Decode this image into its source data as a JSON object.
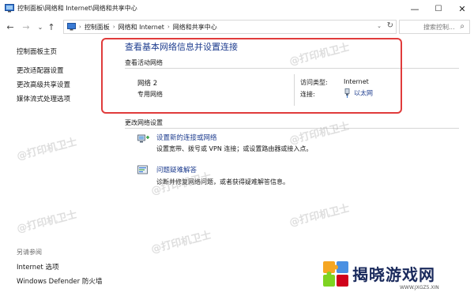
{
  "window": {
    "title": "控制面板\\网络和 Internet\\网络和共享中心",
    "minimize": "—",
    "maximize": "☐",
    "close": "✕"
  },
  "nav": {
    "back": "←",
    "forward": "→",
    "recent": "⌄",
    "up": "↑"
  },
  "address": {
    "crumbs": [
      "控制面板",
      "网络和 Internet",
      "网络和共享中心"
    ],
    "sep": "›",
    "dropdown": "⌄",
    "refresh": "↻"
  },
  "search": {
    "placeholder": "搜索控制...",
    "icon": "⌕"
  },
  "sidebar": {
    "items": [
      {
        "label": "控制面板主页"
      },
      {
        "label": "更改适配器设置"
      },
      {
        "label": "更改高级共享设置"
      },
      {
        "label": "媒体流式处理选项"
      }
    ],
    "see_also_title": "另请参阅",
    "see_also": [
      {
        "label": "Internet 选项"
      },
      {
        "label": "Windows Defender 防火墙"
      }
    ]
  },
  "main": {
    "heading": "查看基本网络信息并设置连接",
    "active_section": "查看活动网络",
    "network": {
      "name": "网络 2",
      "type": "专用网络",
      "access_label": "访问类型:",
      "access_value": "Internet",
      "conn_label": "连接:",
      "conn_value": "以太网"
    },
    "change_section": "更改网络设置",
    "tasks": [
      {
        "title": "设置新的连接或网络",
        "desc": "设置宽带、拨号或 VPN 连接；或设置路由器或接入点。"
      },
      {
        "title": "问题疑难解答",
        "desc": "诊断并修复网络问题，或者获得疑难解答信息。"
      }
    ]
  },
  "watermark": "@打印机卫士",
  "logo": {
    "brand": "揭晓游戏网",
    "site": "WWW.JXGZ5.XIN"
  },
  "colors": {
    "link": "#1e3d8f",
    "highlight_box": "#e03b3b"
  }
}
